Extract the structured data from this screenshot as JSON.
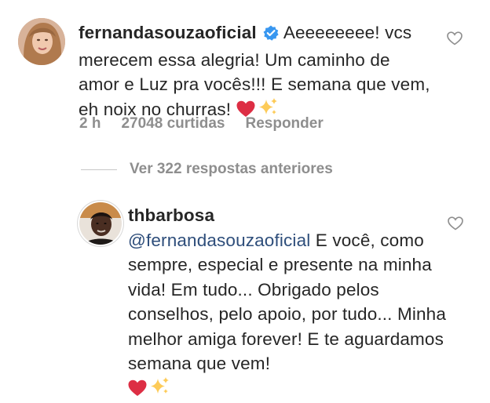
{
  "comments": [
    {
      "username": "fernandasouzaoficial",
      "verified": true,
      "text": "Aeeeeeeee! vcs merecem essa alegria! Um caminho de amor e Luz pra vocês!!! E semana que vem, eh noix no churras!",
      "emojis": [
        "red-heart",
        "sparkles"
      ],
      "time": "2 h",
      "likes": "27048 curtidas",
      "reply_label": "Responder"
    },
    {
      "username": "thbarbosa",
      "mention": "@fernandasouzaoficial",
      "text": "E você, como sempre, especial e presente na minha vida! Em tudo... Obrigado pelos conselhos, pelo apoio, por tudo... Minha melhor amiga forever! E te aguardamos semana que vem!",
      "emojis": [
        "red-heart",
        "sparkles"
      ]
    }
  ],
  "view_replies": "Ver 322 respostas anteriores",
  "colors": {
    "mention": "#2d4d7a",
    "verified": "#3897f0",
    "meta": "#8e8e8e"
  }
}
